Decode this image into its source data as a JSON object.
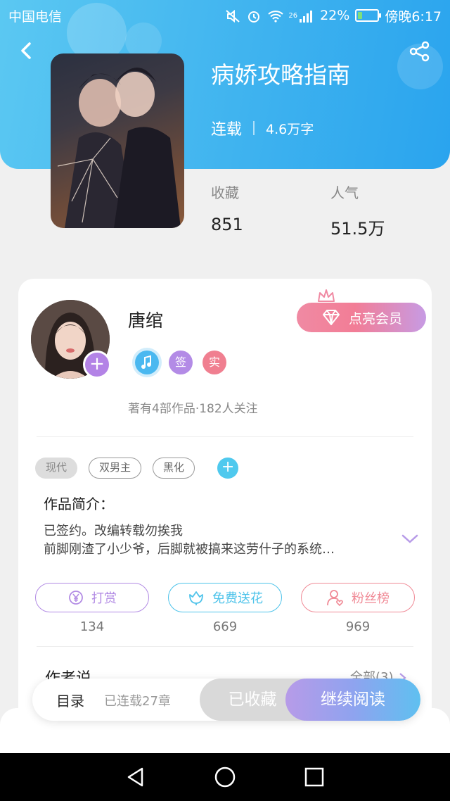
{
  "status_bar": {
    "carrier": "中国电信",
    "network": "26",
    "battery": "22%",
    "battery_level": 0.22,
    "time": "傍晚6:17"
  },
  "book": {
    "title": "病娇攻略指南",
    "status": "连载",
    "word_count": "4.6万字",
    "stats": [
      {
        "label": "收藏",
        "value": "851"
      },
      {
        "label": "人气",
        "value": "51.5万"
      }
    ]
  },
  "author": {
    "name": "唐绾",
    "vip_label": "点亮会员",
    "badges": [
      {
        "icon": "music-note-icon",
        "text": "",
        "color": "#4ab8f0"
      },
      {
        "icon": "sign-badge",
        "text": "签",
        "color": "#b38be6"
      },
      {
        "icon": "real-name-badge",
        "text": "实",
        "color": "#f07f90"
      }
    ],
    "followers_text": "著有4部作品·182人关注"
  },
  "tags": [
    "现代",
    "双男主",
    "黑化"
  ],
  "intro": {
    "title": "作品简介：",
    "text": "已签约。改编转载勿挨我\n前脚刚渣了小少爷，后脚就被搞来这劳什子的系统…"
  },
  "actions": [
    {
      "label": "打赏",
      "count": "134",
      "color": "#b28be4",
      "icon": "yen-coin-icon"
    },
    {
      "label": "免费送花",
      "count": "669",
      "color": "#4ec3ea",
      "icon": "flower-icon"
    },
    {
      "label": "粉丝榜",
      "count": "969",
      "color": "#f08a96",
      "icon": "fan-person-icon"
    }
  ],
  "author_says": {
    "title": "作者说",
    "all_label": "全部(3)"
  },
  "bottom_bar": {
    "toc_label": "目录",
    "chapters_label": "已连载27章",
    "collected_label": "已收藏",
    "continue_label": "继续阅读"
  },
  "colors": {
    "header_gradient_start": "#5bc8f2",
    "header_gradient_end": "#2aa4ee",
    "accent_purple": "#b383e6"
  }
}
